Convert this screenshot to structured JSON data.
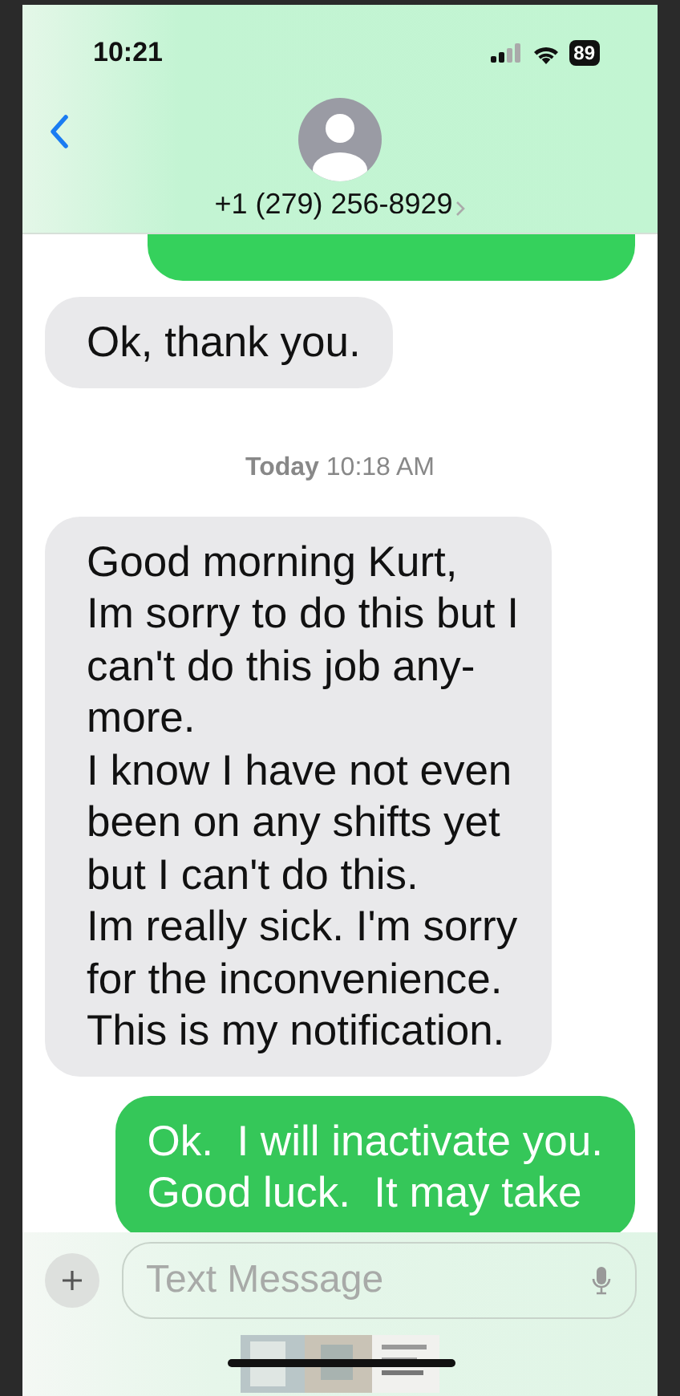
{
  "status_bar": {
    "time": "10:21",
    "battery": "89"
  },
  "header": {
    "contact": "+1 (279) 256-8929"
  },
  "messages": [
    {
      "kind": "sent_partial"
    },
    {
      "kind": "received",
      "text": "Ok, thank you."
    },
    {
      "kind": "timestamp",
      "day": "Today",
      "time": "10:18 AM"
    },
    {
      "kind": "received",
      "text": "Good morning Kurt,\nIm sorry to do this but I\ncan't do this job any-\nmore.\nI know I have not even\nbeen on any shifts yet\nbut I can't do this.\nIm really sick. I'm sorry\nfor the inconvenience.\nThis is my notification."
    },
    {
      "kind": "sent",
      "text": "Ok.  I will inactivate you.\nGood luck.  It may take"
    }
  ],
  "compose": {
    "placeholder": "Text Message"
  }
}
